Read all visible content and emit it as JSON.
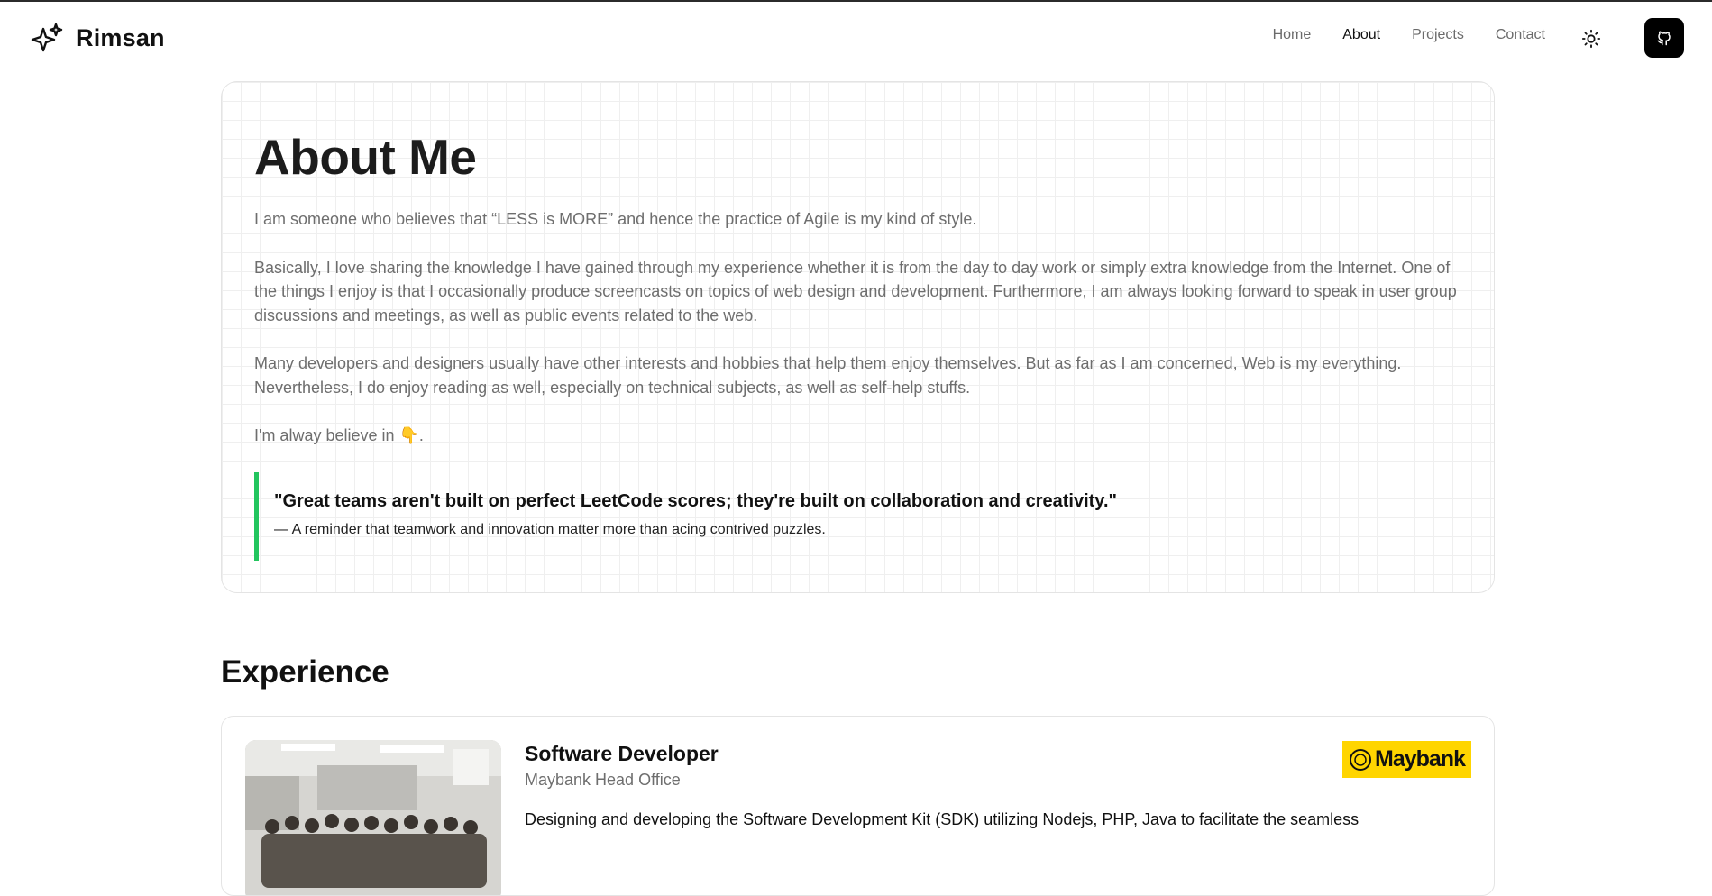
{
  "header": {
    "brand": "Rimsan",
    "brand_icon": "sparkles-icon",
    "nav": [
      {
        "label": "Home",
        "active": false
      },
      {
        "label": "About",
        "active": true
      },
      {
        "label": "Projects",
        "active": false
      },
      {
        "label": "Contact",
        "active": false
      }
    ],
    "theme_icon": "sun-icon",
    "github_icon": "github-icon"
  },
  "about": {
    "title": "About Me",
    "paragraphs": [
      "I am someone who believes that “LESS is MORE” and hence the practice of Agile is my kind of style.",
      "Basically, I love sharing the knowledge I have gained through my experience whether it is from the day to day work or simply extra knowledge from the Internet. One of the things I enjoy is that I occasionally produce screencasts on topics of web design and development. Furthermore, I am always looking forward to speak in user group discussions and meetings, as well as public events related to the web.",
      "Many developers and designers usually have other interests and hobbies that help them enjoy themselves. But as far as I am concerned, Web is my everything. Nevertheless, I do enjoy reading as well, especially on technical subjects, as well as self-help stuffs.",
      "I'm alway believe in 👇."
    ],
    "quote": "\"Great teams aren't built on perfect LeetCode scores; they're built on collaboration and creativity.\"",
    "quote_caption": "— A reminder that teamwork and innovation matter more than acing contrived puzzles.",
    "quote_accent": "#22c55e"
  },
  "experience": {
    "title": "Experience",
    "items": [
      {
        "role": "Software Developer",
        "company": "Maybank Head Office",
        "description": "Designing and developing the Software Development Kit (SDK) utilizing Nodejs, PHP, Java to facilitate the seamless",
        "logo_text": "Maybank",
        "logo_color": "#ffd500"
      }
    ]
  }
}
